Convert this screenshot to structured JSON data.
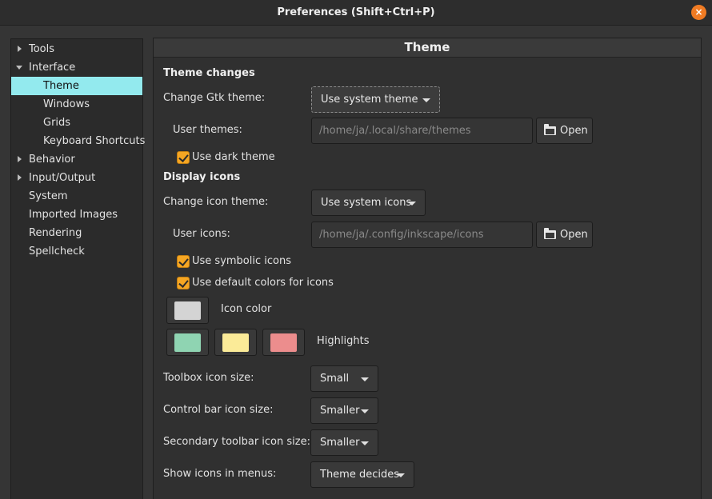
{
  "window": {
    "title": "Preferences (Shift+Ctrl+P)",
    "close_symbol": "×"
  },
  "sidebar": {
    "items": [
      {
        "label": "Tools",
        "expander": "collapsed"
      },
      {
        "label": "Interface",
        "expander": "expanded"
      },
      {
        "label": "Theme",
        "selected": true
      },
      {
        "label": "Windows"
      },
      {
        "label": "Grids"
      },
      {
        "label": "Keyboard Shortcuts"
      },
      {
        "label": "Behavior",
        "expander": "collapsed"
      },
      {
        "label": "Input/Output",
        "expander": "collapsed"
      },
      {
        "label": "System"
      },
      {
        "label": "Imported Images"
      },
      {
        "label": "Rendering"
      },
      {
        "label": "Spellcheck"
      }
    ]
  },
  "panel": {
    "title": "Theme",
    "theme_changes": {
      "heading": "Theme changes",
      "gtk_theme_label": "Change Gtk theme:",
      "gtk_theme_value": "Use system theme",
      "user_themes_label": "User themes:",
      "user_themes_path": "/home/ja/.local/share/themes",
      "open_label": "Open",
      "dark_theme_label": "Use dark theme",
      "dark_theme_checked": true
    },
    "display_icons": {
      "heading": "Display icons",
      "icon_theme_label": "Change icon theme:",
      "icon_theme_value": "Use system icons",
      "user_icons_label": "User icons:",
      "user_icons_path": "/home/ja/.config/inkscape/icons",
      "open_label": "Open",
      "symbolic_label": "Use symbolic icons",
      "symbolic_checked": true,
      "default_colors_label": "Use default colors for icons",
      "default_colors_checked": true,
      "icon_color_label": "Icon color",
      "icon_color": "#d4d4d4",
      "highlights_label": "Highlights",
      "highlight_colors": [
        "#8fd4b2",
        "#fbeb98",
        "#ec8d8d"
      ]
    },
    "sizes": {
      "toolbox_label": "Toolbox icon size:",
      "toolbox_value": "Small",
      "control_bar_label": "Control bar icon size:",
      "control_bar_value": "Smaller",
      "secondary_label": "Secondary toolbar icon size:",
      "secondary_value": "Smaller",
      "menus_label": "Show icons in menus:",
      "menus_value": "Theme decides"
    }
  },
  "colors": {
    "accent_selection": "#93eaee",
    "checkbox": "#f5a623",
    "close_button": "#f07b23"
  }
}
